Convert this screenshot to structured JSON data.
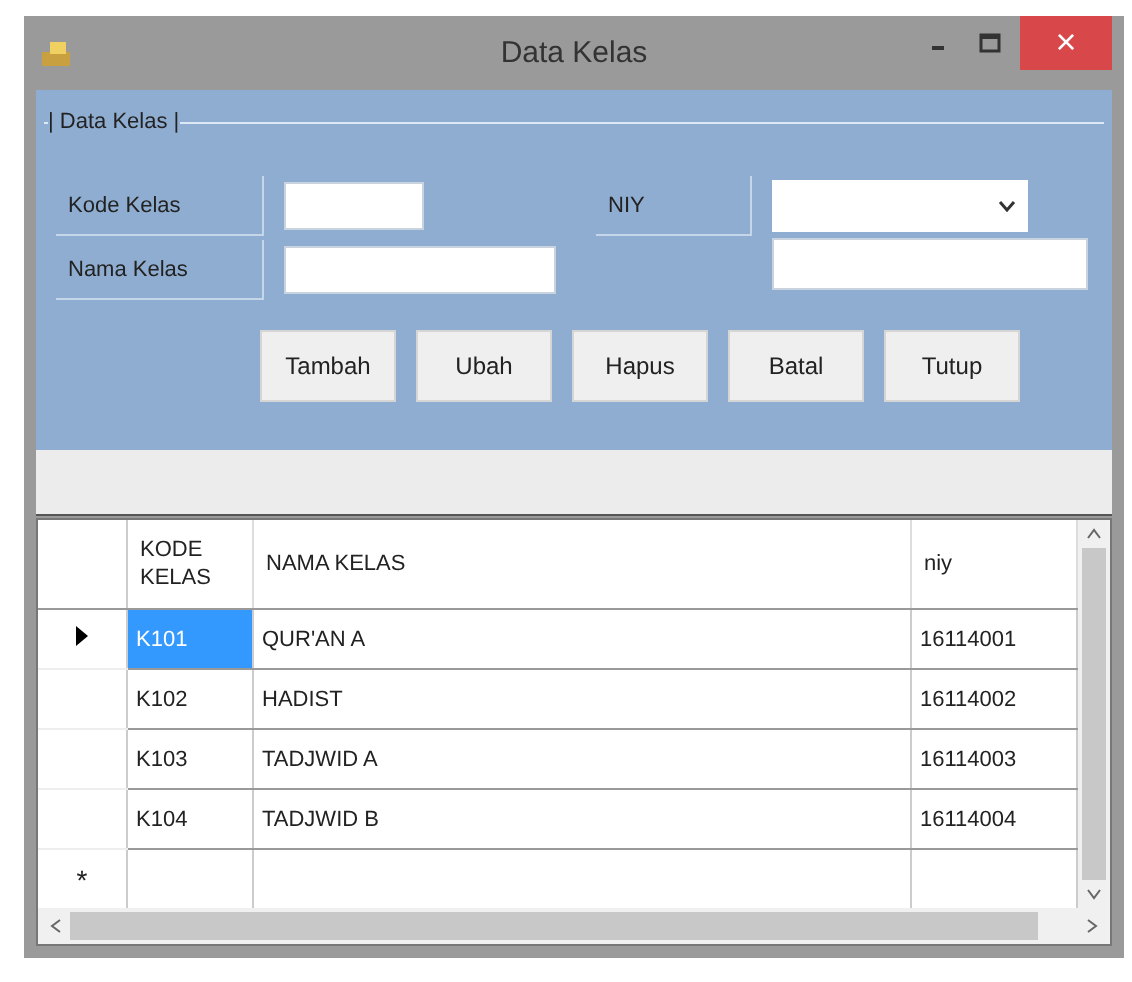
{
  "window": {
    "title": "Data Kelas",
    "close": "×"
  },
  "group": {
    "title": "| Data Kelas |"
  },
  "form": {
    "fields": [
      {
        "label": "Kode Kelas",
        "kind": "text"
      },
      {
        "label": "Nama Kelas",
        "kind": "text"
      },
      {
        "label": "NIY",
        "kind": "combo"
      }
    ],
    "extra_field": {
      "kind": "text"
    }
  },
  "buttons": [
    "Tambah",
    "Ubah",
    "Hapus",
    "Batal",
    "Tutup"
  ],
  "table": {
    "columns": [
      "KODE KELAS",
      "NAMA KELAS",
      "niy"
    ],
    "rows": [
      {
        "cells": [
          "K101",
          "QUR'AN A",
          "16114001"
        ],
        "selected": true
      },
      {
        "cells": [
          "K102",
          "HADIST",
          "16114002"
        ],
        "selected": false
      },
      {
        "cells": [
          "K103",
          "TADJWID A",
          "16114003"
        ],
        "selected": false
      },
      {
        "cells": [
          "K104",
          "TADJWID B",
          "16114004"
        ],
        "selected": false
      }
    ],
    "new_row_marker": "*"
  }
}
